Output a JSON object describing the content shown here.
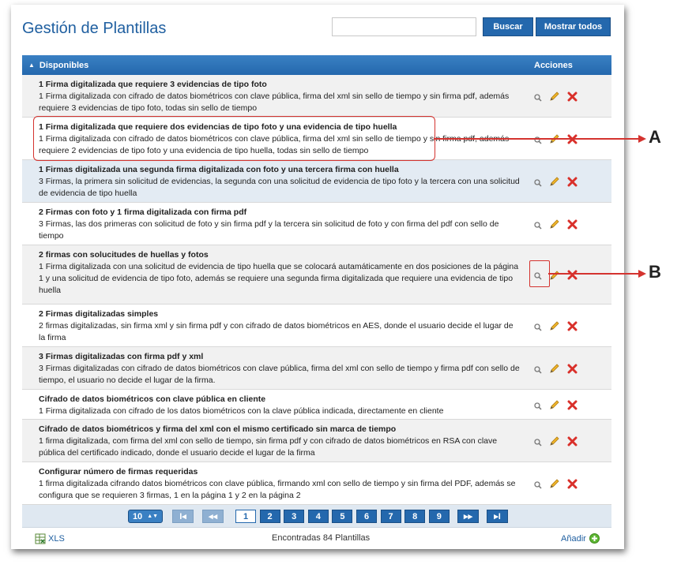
{
  "header": {
    "title": "Gestión de Plantillas",
    "search_value": "",
    "search_button": "Buscar",
    "show_all_button": "Mostrar todos"
  },
  "table": {
    "group_label": "Disponibles",
    "actions_header": "Acciones",
    "rows": [
      {
        "name": "1 Firma digitalizada que requiere 3 evidencias de tipo foto",
        "desc": "1 Firma digitalizada con cifrado de datos biométricos con clave pública, firma del xml sin sello de tiempo y sin firma pdf, además requiere 3 evidencias de tipo foto, todas sin sello de tiempo"
      },
      {
        "name": "1 Firma digitalizada que requiere dos evidencias de tipo foto y una evidencia de tipo huella",
        "desc": "1 Firma digitalizada con cifrado de datos biométricos con clave pública, firma del xml sin sello de tiempo y sin firma pdf, además requiere 2 evidencias de tipo foto y una evidencia de tipo huella, todas sin sello de tiempo"
      },
      {
        "name": "1 Firmas digitalizada una segunda firma digitalizada con foto y una tercera firma con huella",
        "desc": "3 Firmas, la primera sin solicitud de evidencias, la segunda con una solicitud de evidencia de tipo foto y la tercera con una solicitud de evidencia de tipo huella"
      },
      {
        "name": "2 Firmas con foto y 1 firma digitalizada con firma pdf",
        "desc": "3 Firmas, las dos primeras con solicitud de foto y sin firma pdf y la tercera sin solicitud de foto y con firma del pdf con sello de tiempo"
      },
      {
        "name": "2 firmas con solucitudes de huellas y fotos",
        "desc": "1 Firma digitalizada con una solicitud de evidencia de tipo huella que se colocará autamáticamente en dos posiciones de la página 1 y una solicitud de evidencia de tipo foto, además se requiere una segunda firma digitalizada que requiere una evidencia de tipo huella"
      },
      {
        "name": "2 Firmas digitalizadas simples",
        "desc": "2 firmas digitalizadas, sin firma xml y sin firma pdf y con cifrado de datos biométricos en AES, donde el usuario decide el lugar de la firma"
      },
      {
        "name": "3 Firmas digitalizadas con firma pdf y xml",
        "desc": "3 Firmas digitalizadas con cifrado de datos biométricos con clave pública, firma del xml con sello de tiempo y firma pdf con sello de tiempo, el usuario no decide el lugar de la firma."
      },
      {
        "name": "Cifrado de datos biométricos con clave pública en cliente",
        "desc": "1 Firma digitalizada con cifrado de los datos biométricos con la clave pública indicada, directamente en cliente"
      },
      {
        "name": "Cifrado de datos biométricos y firma del xml con el mismo certificado sin marca de tiempo",
        "desc": "1 firma digitalizada, com firma del xml con sello de tiempo, sin firma pdf y con cifrado de datos biométricos en RSA con clave pública del certificado indicado, donde el usuario decide el lugar de la firma"
      },
      {
        "name": "Configurar número de firmas requeridas",
        "desc": "1 firma digitalizada cifrando datos biométricos con clave pública, firmando xml con sello de tiempo y sin firma del PDF, además se configura que se requieren 3 firmas, 1 en la página 1 y 2 en la página 2"
      }
    ]
  },
  "pager": {
    "page_size": "10",
    "first": "I◂",
    "prev": "◂◂",
    "pages": [
      "1",
      "2",
      "3",
      "4",
      "5",
      "6",
      "7",
      "8",
      "9"
    ],
    "current": "1",
    "next": "▸▸",
    "last": "▸I"
  },
  "footer": {
    "export_label": "XLS",
    "count_text": "Encontradas 84 Plantillas",
    "add_label": "Añadir"
  },
  "annotations": {
    "label_a": "A",
    "label_b": "B"
  },
  "colors": {
    "accent": "#2468ad",
    "title": "#1f5fa0",
    "callout": "#d4332f",
    "delete": "#d9302a",
    "edit": "#e8a21a"
  }
}
